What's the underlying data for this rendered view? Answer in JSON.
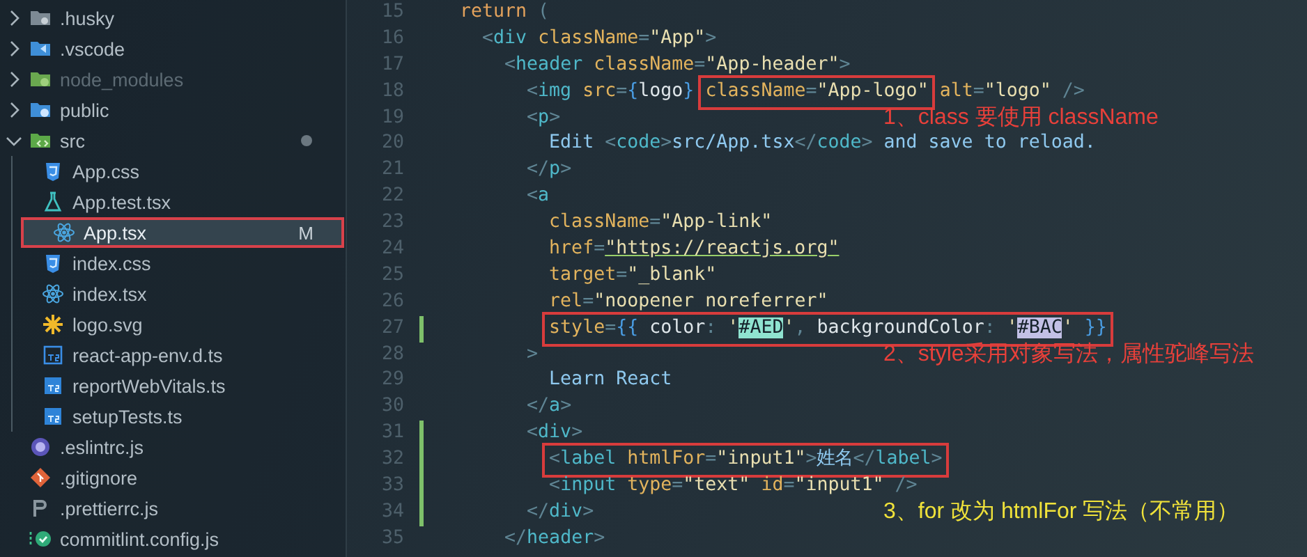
{
  "explorer": {
    "items": [
      {
        "name": ".husky",
        "kind": "folder-husky",
        "expanded": false,
        "ignored": false,
        "selected": false,
        "changed": false
      },
      {
        "name": ".vscode",
        "kind": "folder-vscode",
        "expanded": false,
        "ignored": false,
        "selected": false,
        "changed": false
      },
      {
        "name": "node_modules",
        "kind": "folder-node",
        "expanded": false,
        "ignored": true,
        "selected": false,
        "changed": false
      },
      {
        "name": "public",
        "kind": "folder-public",
        "expanded": false,
        "ignored": false,
        "selected": false,
        "changed": false
      },
      {
        "name": "src",
        "kind": "folder-src",
        "expanded": true,
        "ignored": false,
        "selected": false,
        "changed": true,
        "children": [
          {
            "name": "App.css",
            "kind": "css",
            "selected": false
          },
          {
            "name": "App.test.tsx",
            "kind": "test",
            "selected": false
          },
          {
            "name": "App.tsx",
            "kind": "react",
            "selected": true,
            "badge": "M"
          },
          {
            "name": "index.css",
            "kind": "css",
            "selected": false
          },
          {
            "name": "index.tsx",
            "kind": "react",
            "selected": false
          },
          {
            "name": "logo.svg",
            "kind": "svg",
            "selected": false
          },
          {
            "name": "react-app-env.d.ts",
            "kind": "ts-outline",
            "selected": false
          },
          {
            "name": "reportWebVitals.ts",
            "kind": "ts",
            "selected": false
          },
          {
            "name": "setupTests.ts",
            "kind": "ts",
            "selected": false
          }
        ]
      },
      {
        "name": ".eslintrc.js",
        "kind": "eslint",
        "selected": false
      },
      {
        "name": ".gitignore",
        "kind": "git",
        "selected": false
      },
      {
        "name": ".prettierrc.js",
        "kind": "prettier",
        "selected": false
      },
      {
        "name": "commitlint.config.js",
        "kind": "commitlint",
        "selected": false
      }
    ]
  },
  "editor": {
    "lines": [
      {
        "number": "15",
        "modified": false,
        "tokens": [
          {
            "kind": "kw",
            "text": "return "
          },
          {
            "kind": "punct",
            "text": "("
          }
        ],
        "children": [
          {
            "number": "16",
            "modified": false,
            "tokens": [
              {
                "kind": "punct",
                "text": "<"
              },
              {
                "kind": "tag",
                "text": "div "
              },
              {
                "kind": "attr",
                "text": "className"
              },
              {
                "kind": "punct",
                "text": "="
              },
              {
                "kind": "str",
                "text": "\"App\""
              },
              {
                "kind": "punct",
                "text": ">"
              }
            ],
            "children": [
              {
                "number": "17",
                "modified": false,
                "tokens": [
                  {
                    "kind": "punct",
                    "text": "<"
                  },
                  {
                    "kind": "tag",
                    "text": "header "
                  },
                  {
                    "kind": "attr",
                    "text": "className"
                  },
                  {
                    "kind": "punct",
                    "text": "="
                  },
                  {
                    "kind": "str",
                    "text": "\"App-header\""
                  },
                  {
                    "kind": "punct",
                    "text": ">"
                  }
                ],
                "children": [
                  {
                    "number": "18",
                    "modified": false,
                    "tokens": [
                      {
                        "kind": "punct",
                        "text": "<"
                      },
                      {
                        "kind": "tag",
                        "text": "img "
                      },
                      {
                        "kind": "attr",
                        "text": "src"
                      },
                      {
                        "kind": "punct",
                        "text": "="
                      },
                      {
                        "kind": "brace",
                        "text": "{"
                      },
                      {
                        "kind": "ident",
                        "text": "logo"
                      },
                      {
                        "kind": "brace",
                        "text": "} "
                      },
                      {
                        "kind": "box",
                        "tokens": [
                          {
                            "kind": "attr",
                            "text": "className"
                          },
                          {
                            "kind": "punct",
                            "text": "="
                          },
                          {
                            "kind": "str",
                            "text": "\"App-logo\""
                          }
                        ]
                      },
                      {
                        "kind": "attr",
                        "text": " alt"
                      },
                      {
                        "kind": "punct",
                        "text": "="
                      },
                      {
                        "kind": "str",
                        "text": "\"logo\" "
                      },
                      {
                        "kind": "punct",
                        "text": "/>"
                      }
                    ]
                  },
                  {
                    "number": "19",
                    "modified": false,
                    "tokens": [
                      {
                        "kind": "punct",
                        "text": "<"
                      },
                      {
                        "kind": "tag",
                        "text": "p"
                      },
                      {
                        "kind": "punct",
                        "text": ">"
                      }
                    ],
                    "note": {
                      "text": "1、class 要使用 className",
                      "color": "#e8403a"
                    },
                    "children": [
                      {
                        "number": "20",
                        "modified": false,
                        "tokens": [
                          {
                            "kind": "text",
                            "text": "Edit "
                          },
                          {
                            "kind": "punct",
                            "text": "<"
                          },
                          {
                            "kind": "tag",
                            "text": "code"
                          },
                          {
                            "kind": "punct",
                            "text": ">"
                          },
                          {
                            "kind": "text",
                            "text": "src/App.tsx"
                          },
                          {
                            "kind": "punct",
                            "text": "</"
                          },
                          {
                            "kind": "tag",
                            "text": "code"
                          },
                          {
                            "kind": "punct",
                            "text": ">"
                          },
                          {
                            "kind": "text",
                            "text": " and save to reload."
                          }
                        ]
                      }
                    ]
                  },
                  {
                    "number": "21",
                    "modified": false,
                    "tokens": [
                      {
                        "kind": "punct",
                        "text": "</"
                      },
                      {
                        "kind": "tag",
                        "text": "p"
                      },
                      {
                        "kind": "punct",
                        "text": ">"
                      }
                    ]
                  },
                  {
                    "number": "22",
                    "modified": false,
                    "tokens": [
                      {
                        "kind": "punct",
                        "text": "<"
                      },
                      {
                        "kind": "tag",
                        "text": "a"
                      }
                    ],
                    "children": [
                      {
                        "number": "23",
                        "modified": false,
                        "tokens": [
                          {
                            "kind": "attr",
                            "text": "className"
                          },
                          {
                            "kind": "punct",
                            "text": "="
                          },
                          {
                            "kind": "str",
                            "text": "\"App-link\""
                          }
                        ]
                      },
                      {
                        "number": "24",
                        "modified": false,
                        "tokens": [
                          {
                            "kind": "attr",
                            "text": "href"
                          },
                          {
                            "kind": "punct",
                            "text": "="
                          },
                          {
                            "kind": "link",
                            "text": "\"https://reactjs.org\""
                          }
                        ]
                      },
                      {
                        "number": "25",
                        "modified": false,
                        "tokens": [
                          {
                            "kind": "attr",
                            "text": "target"
                          },
                          {
                            "kind": "punct",
                            "text": "="
                          },
                          {
                            "kind": "str",
                            "text": "\"_blank\""
                          }
                        ]
                      },
                      {
                        "number": "26",
                        "modified": false,
                        "tokens": [
                          {
                            "kind": "attr",
                            "text": "rel"
                          },
                          {
                            "kind": "punct",
                            "text": "="
                          },
                          {
                            "kind": "str",
                            "text": "\"noopener noreferrer\""
                          }
                        ]
                      },
                      {
                        "number": "27",
                        "modified": true,
                        "tokens": [
                          {
                            "kind": "box",
                            "tokens": [
                              {
                                "kind": "attr",
                                "text": "style"
                              },
                              {
                                "kind": "punct",
                                "text": "="
                              },
                              {
                                "kind": "brace",
                                "text": "{{ "
                              },
                              {
                                "kind": "ident",
                                "text": "color"
                              },
                              {
                                "kind": "punct",
                                "text": ": "
                              },
                              {
                                "kind": "str",
                                "text": "'"
                              },
                              {
                                "kind": "match",
                                "text": "#AED",
                                "color": "#8fe3d0"
                              },
                              {
                                "kind": "str",
                                "text": "'"
                              },
                              {
                                "kind": "punct",
                                "text": ", "
                              },
                              {
                                "kind": "ident",
                                "text": "backgroundColor"
                              },
                              {
                                "kind": "punct",
                                "text": ": "
                              },
                              {
                                "kind": "str",
                                "text": "'"
                              },
                              {
                                "kind": "match",
                                "text": "#BAC",
                                "color": "#c2c0e6"
                              },
                              {
                                "kind": "str",
                                "text": "'"
                              },
                              {
                                "kind": "brace",
                                "text": " }}"
                              }
                            ]
                          }
                        ]
                      }
                    ]
                  },
                  {
                    "number": "28",
                    "modified": false,
                    "tokens": [
                      {
                        "kind": "punct",
                        "text": ">"
                      }
                    ],
                    "note": {
                      "text": "2、style采用对象写法，属性驼峰写法",
                      "color": "#e8403a"
                    },
                    "children": [
                      {
                        "number": "29",
                        "modified": false,
                        "tokens": [
                          {
                            "kind": "text",
                            "text": "Learn React"
                          }
                        ]
                      }
                    ]
                  },
                  {
                    "number": "30",
                    "modified": false,
                    "tokens": [
                      {
                        "kind": "punct",
                        "text": "</"
                      },
                      {
                        "kind": "tag",
                        "text": "a"
                      },
                      {
                        "kind": "punct",
                        "text": ">"
                      }
                    ]
                  },
                  {
                    "number": "31",
                    "modified": true,
                    "tokens": [
                      {
                        "kind": "punct",
                        "text": "<"
                      },
                      {
                        "kind": "tag",
                        "text": "div"
                      },
                      {
                        "kind": "punct",
                        "text": ">"
                      }
                    ],
                    "children": [
                      {
                        "number": "32",
                        "modified": true,
                        "tokens": [
                          {
                            "kind": "box",
                            "tokens": [
                              {
                                "kind": "punct",
                                "text": "<"
                              },
                              {
                                "kind": "tag",
                                "text": "label "
                              },
                              {
                                "kind": "attr",
                                "text": "htmlFor"
                              },
                              {
                                "kind": "punct",
                                "text": "="
                              },
                              {
                                "kind": "str",
                                "text": "\"input1\""
                              },
                              {
                                "kind": "punct",
                                "text": ">"
                              },
                              {
                                "kind": "text",
                                "text": "姓名"
                              },
                              {
                                "kind": "punct",
                                "text": "</"
                              },
                              {
                                "kind": "tag",
                                "text": "label"
                              },
                              {
                                "kind": "punct",
                                "text": ">"
                              }
                            ]
                          }
                        ]
                      },
                      {
                        "number": "33",
                        "modified": true,
                        "tokens": [
                          {
                            "kind": "punct",
                            "text": "<"
                          },
                          {
                            "kind": "tag",
                            "text": "input "
                          },
                          {
                            "kind": "attr",
                            "text": "type"
                          },
                          {
                            "kind": "punct",
                            "text": "="
                          },
                          {
                            "kind": "str",
                            "text": "\"text\" "
                          },
                          {
                            "kind": "attr",
                            "text": "id"
                          },
                          {
                            "kind": "punct",
                            "text": "="
                          },
                          {
                            "kind": "str",
                            "text": "\"input1\" "
                          },
                          {
                            "kind": "punct",
                            "text": "/>"
                          }
                        ]
                      }
                    ]
                  },
                  {
                    "number": "34",
                    "modified": true,
                    "tokens": [
                      {
                        "kind": "punct",
                        "text": "</"
                      },
                      {
                        "kind": "tag",
                        "text": "div"
                      },
                      {
                        "kind": "punct",
                        "text": ">"
                      }
                    ],
                    "note": {
                      "text": "3、for 改为 htmlFor 写法（不常用）",
                      "color": "#f0e23a"
                    }
                  }
                ]
              },
              {
                "number": "35",
                "modified": false,
                "tokens": [
                  {
                    "kind": "punct",
                    "text": "</"
                  },
                  {
                    "kind": "tag",
                    "text": "header"
                  },
                  {
                    "kind": "punct",
                    "text": ">"
                  }
                ]
              }
            ]
          }
        ]
      }
    ]
  }
}
